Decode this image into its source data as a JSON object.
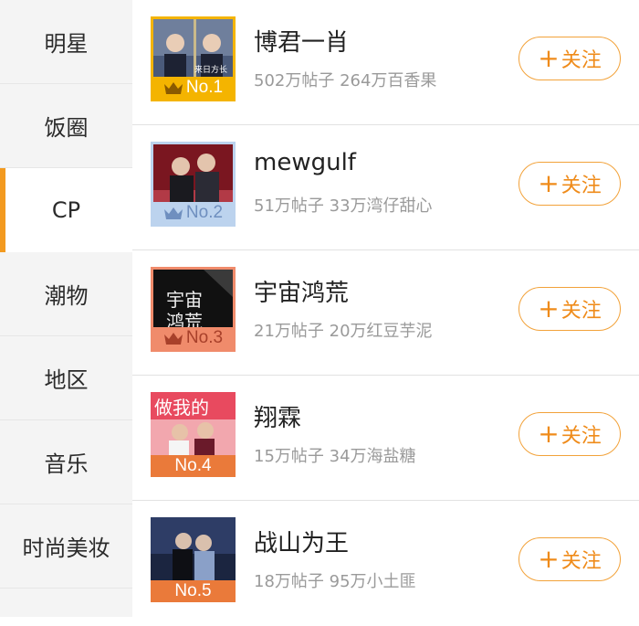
{
  "sidebar": {
    "items": [
      {
        "label": "明星"
      },
      {
        "label": "饭圈"
      },
      {
        "label": "CP"
      },
      {
        "label": "潮物"
      },
      {
        "label": "地区"
      },
      {
        "label": "音乐"
      },
      {
        "label": "时尚美妆"
      }
    ],
    "active_index": 2,
    "accent_color": "#f39a1f"
  },
  "list": {
    "follow_label": "关注",
    "follow_icon": "plus-icon",
    "rows": [
      {
        "title": "博君一肖",
        "stats": "502万帖子 264万百香果",
        "rank": "No.1",
        "rank_color": "#f4b400",
        "has_crown": true
      },
      {
        "title": "mewgulf",
        "stats": "51万帖子 33万湾仔甜心",
        "rank": "No.2",
        "rank_color": "#bcd3ee",
        "has_crown": true
      },
      {
        "title": "宇宙鸿荒",
        "stats": "21万帖子 20万红豆芋泥",
        "rank": "No.3",
        "rank_color": "#f08b6b",
        "has_crown": true
      },
      {
        "title": "翔霖",
        "stats": "15万帖子 34万海盐糖",
        "rank": "No.4",
        "rank_color": "#ea7a3a",
        "has_crown": false
      },
      {
        "title": "战山为王",
        "stats": "18万帖子 95万小土匪",
        "rank": "No.5",
        "rank_color": "#ea7a3a",
        "has_crown": false
      }
    ]
  }
}
